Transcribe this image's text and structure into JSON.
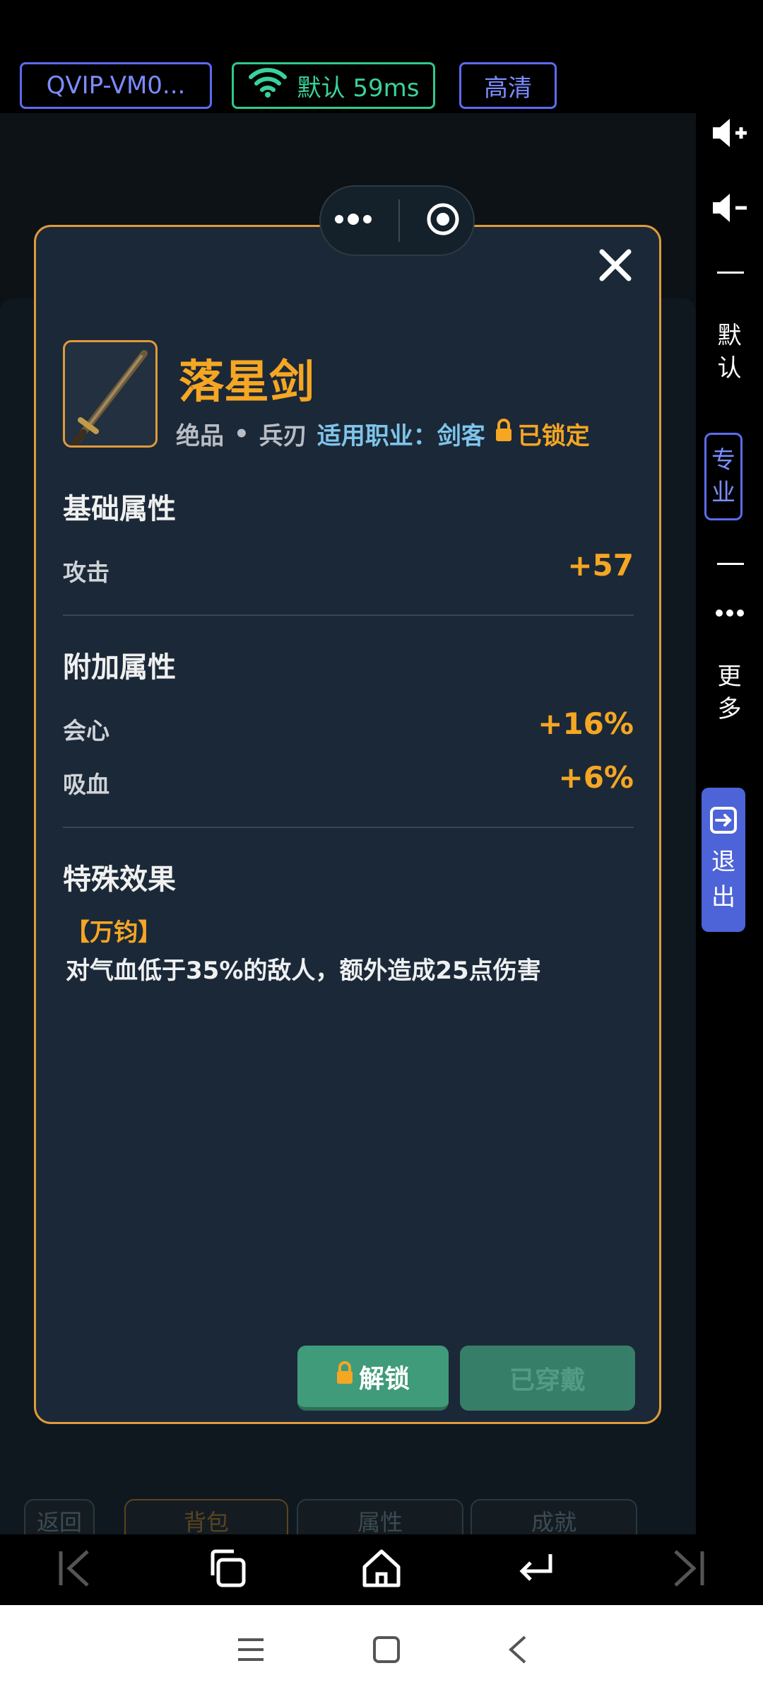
{
  "top_bar": {
    "device_name": "QVIP-VM0...",
    "network_label": "默认 59ms",
    "quality_label": "高清"
  },
  "background": {
    "tabs": [
      "返回",
      "背包",
      "属性",
      "成就"
    ]
  },
  "item": {
    "name": "落星剑",
    "grade": "绝品",
    "dot": "•",
    "type": "兵刃",
    "class_label": "适用职业：剑客",
    "lock_status": "已锁定"
  },
  "sections": {
    "base_title": "基础属性",
    "base_stats": [
      {
        "label": "攻击",
        "value": "+57"
      }
    ],
    "extra_title": "附加属性",
    "extra_stats": [
      {
        "label": "会心",
        "value": "+16%"
      },
      {
        "label": "吸血",
        "value": "+6%"
      }
    ],
    "special_title": "特殊效果",
    "effect_name": "【万钧】",
    "effect_desc": "对气血低于35%的敌人，额外造成25点伤害"
  },
  "buttons": {
    "unlock": "解锁",
    "equipped": "已穿戴"
  },
  "sidebar": {
    "default_label_1": "默",
    "default_label_2": "认",
    "pro_label_1": "专",
    "pro_label_2": "业",
    "more_label_1": "更",
    "more_label_2": "多",
    "exit_label_1": "退",
    "exit_label_2": "出"
  },
  "icons": {
    "wifi": "wifi-icon",
    "lock": "lock-icon",
    "close": "close-icon",
    "sword": "sword-icon"
  },
  "colors": {
    "accent_orange": "#f5a623",
    "modal_bg": "#1b2837",
    "class_blue": "#7fc4ea",
    "button_green": "#3f9b7a",
    "chip_blue": "#5b6cf0",
    "chip_green": "#2fc98c"
  }
}
